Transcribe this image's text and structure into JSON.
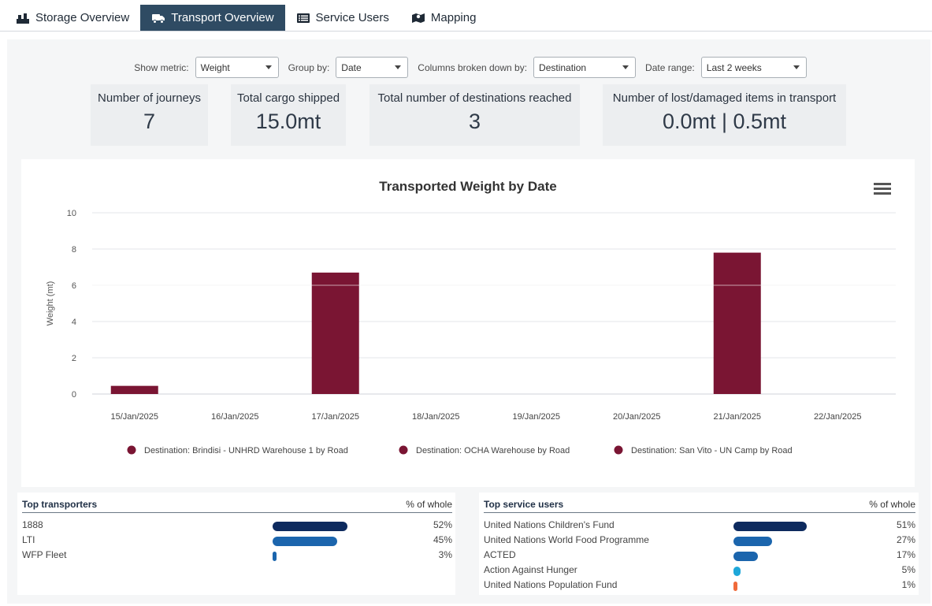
{
  "tabs": [
    {
      "label": "Storage Overview",
      "icon": "storage-icon",
      "active": false
    },
    {
      "label": "Transport Overview",
      "icon": "truck-icon",
      "active": true
    },
    {
      "label": "Service Users",
      "icon": "list-icon",
      "active": false
    },
    {
      "label": "Mapping",
      "icon": "map-icon",
      "active": false
    }
  ],
  "filters": {
    "metric_label": "Show metric:",
    "metric_value": "Weight",
    "group_label": "Group by:",
    "group_value": "Date",
    "columns_label": "Columns broken down by:",
    "columns_value": "Destination",
    "range_label": "Date range:",
    "range_value": "Last 2 weeks"
  },
  "kpis": {
    "journeys": {
      "label": "Number of journeys",
      "value": "7"
    },
    "cargo": {
      "label": "Total cargo shipped",
      "value": "15.0mt"
    },
    "destinations": {
      "label": "Total number of destinations reached",
      "value": "3"
    },
    "lost": {
      "label": "Number of lost/damaged items in transport",
      "value": "0.0mt | 0.5mt"
    }
  },
  "chart_data": {
    "type": "bar",
    "title": "Transported Weight by Date",
    "ylabel": "Weight (mt)",
    "xlabel": "",
    "ylim": [
      0,
      10
    ],
    "yticks": [
      "0",
      "2",
      "4",
      "6",
      "8",
      "10"
    ],
    "grid": true,
    "legend_position": "bottom",
    "categories": [
      "15/Jan/2025",
      "16/Jan/2025",
      "17/Jan/2025",
      "18/Jan/2025",
      "19/Jan/2025",
      "20/Jan/2025",
      "21/Jan/2025",
      "22/Jan/2025"
    ],
    "values": [
      0.45,
      0,
      6.7,
      0,
      0,
      0,
      7.8,
      0
    ],
    "color": "#7a1533",
    "legend": [
      "Destination: Brindisi - UNHRD Warehouse 1 by Road",
      "Destination: OCHA Warehouse by Road",
      "Destination: San Vito - UN Camp by Road"
    ],
    "menu_icon": "hamburger-menu-icon"
  },
  "top_transporters": {
    "title": "Top transporters",
    "pct_header": "% of whole",
    "rows": [
      {
        "name": "1888",
        "pct": "52%",
        "value": 52,
        "color": "#0d2a5e"
      },
      {
        "name": "LTI",
        "pct": "45%",
        "value": 45,
        "color": "#1b65ad"
      },
      {
        "name": "WFP Fleet",
        "pct": "3%",
        "value": 3,
        "color": "#1b65ad"
      }
    ]
  },
  "top_service_users": {
    "title": "Top service users",
    "pct_header": "% of whole",
    "rows": [
      {
        "name": "United Nations Children's Fund",
        "pct": "51%",
        "value": 51,
        "color": "#0d2a5e"
      },
      {
        "name": "United Nations World Food Programme",
        "pct": "27%",
        "value": 27,
        "color": "#1b65ad"
      },
      {
        "name": "ACTED",
        "pct": "17%",
        "value": 17,
        "color": "#1b65ad"
      },
      {
        "name": "Action Against Hunger",
        "pct": "5%",
        "value": 5,
        "color": "#1ea7d9"
      },
      {
        "name": "United Nations Population Fund",
        "pct": "1%",
        "value": 1,
        "color": "#f06a3a"
      }
    ]
  }
}
